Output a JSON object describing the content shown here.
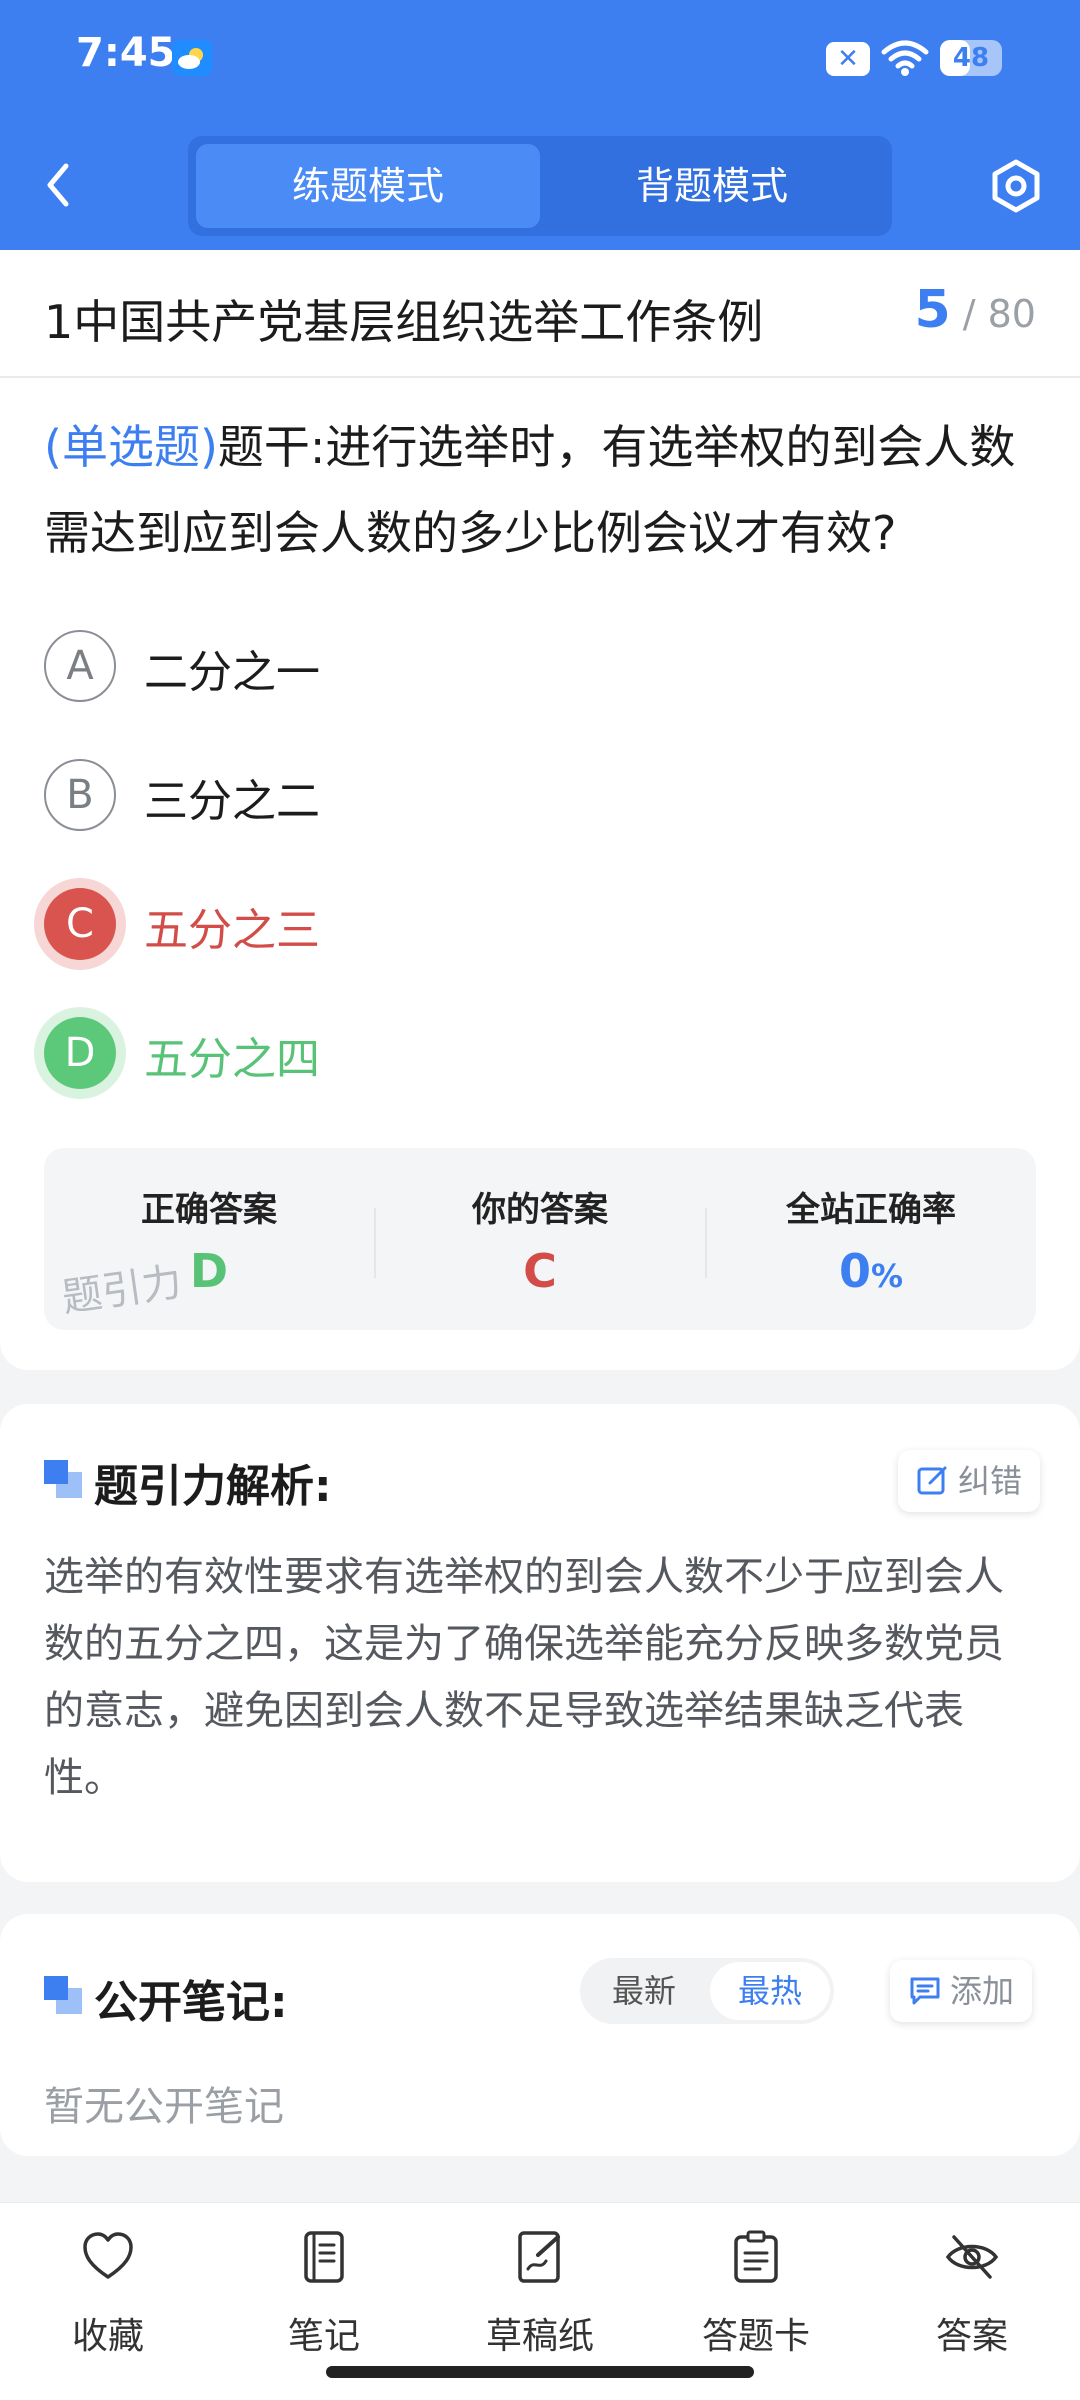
{
  "status_bar": {
    "time": "7:45",
    "battery": "48",
    "battery_level_percent": 48
  },
  "header": {
    "mode_practice": "练题模式",
    "mode_recite": "背题模式"
  },
  "paper": {
    "title": "1中国共产党基层组织选举工作条例",
    "current": "5",
    "total": "/ 80"
  },
  "question": {
    "type_label": "(单选题)",
    "stem": "题干:进行选举时，有选举权的到会人数需达到应到会人数的多少比例会议才有效?",
    "options": [
      {
        "letter": "A",
        "text": "二分之一",
        "state": "normal"
      },
      {
        "letter": "B",
        "text": "三分之二",
        "state": "normal"
      },
      {
        "letter": "C",
        "text": "五分之三",
        "state": "wrong"
      },
      {
        "letter": "D",
        "text": "五分之四",
        "state": "correct"
      }
    ]
  },
  "answers": {
    "correct_label": "正确答案",
    "correct_value": "D",
    "yours_label": "你的答案",
    "yours_value": "C",
    "rate_label": "全站正确率",
    "rate_value": "0",
    "rate_unit": "%",
    "watermark": "题引力"
  },
  "analysis": {
    "title": "题引力解析:",
    "report_button": "纠错",
    "text": "选举的有效性要求有选举权的到会人数不少于应到会人数的五分之四，这是为了确保选举能充分反映多数党员的意志，避免因到会人数不足导致选举结果缺乏代表性。"
  },
  "notes": {
    "title": "公开笔记:",
    "sort_latest": "最新",
    "sort_hot": "最热",
    "add_button": "添加",
    "empty": "暂无公开笔记"
  },
  "bottom_nav": [
    {
      "label": "收藏",
      "icon": "heart-icon"
    },
    {
      "label": "笔记",
      "icon": "notebook-icon"
    },
    {
      "label": "草稿纸",
      "icon": "draft-icon"
    },
    {
      "label": "答题卡",
      "icon": "answer-card-icon"
    },
    {
      "label": "答案",
      "icon": "eye-off-icon"
    }
  ],
  "colors": {
    "primary": "#3d7ff0",
    "wrong": "#d9534f",
    "correct": "#5cc97a"
  }
}
